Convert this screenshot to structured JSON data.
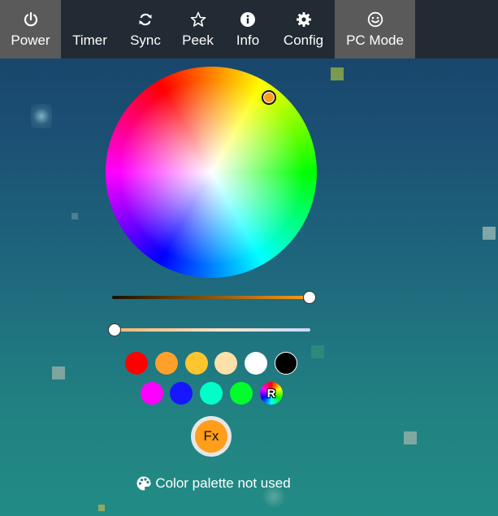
{
  "nav": {
    "tabs": [
      {
        "label": "Power",
        "icon": "power-icon",
        "active": true
      },
      {
        "label": "Timer",
        "icon": "moon-icon",
        "active": false
      },
      {
        "label": "Sync",
        "icon": "sync-icon",
        "active": false
      },
      {
        "label": "Peek",
        "icon": "star-icon",
        "active": false
      },
      {
        "label": "Info",
        "icon": "info-icon",
        "active": false
      },
      {
        "label": "Config",
        "icon": "gear-icon",
        "active": false
      },
      {
        "label": "PC Mode",
        "icon": "smiley-icon",
        "active": true
      }
    ]
  },
  "color_picker": {
    "selected_color": "#ff9e1b",
    "brightness_level": 1.0,
    "white_level": 0.0
  },
  "quick_colors": {
    "row1": [
      "#ff0000",
      "#ffa02a",
      "#ffc52e",
      "#ffe0a8",
      "#ffffff",
      "#000000"
    ],
    "row2": [
      "#ff00ff",
      "#1616ff",
      "#00ffc8",
      "#00ff2a"
    ],
    "random_label": "R"
  },
  "effects_button": {
    "label": "Fx"
  },
  "palette_status": {
    "text": "Color palette not used",
    "icon": "palette-icon"
  },
  "colors": {
    "nav_background": "#222a33",
    "nav_active": "#5a5a5a",
    "accent": "#ff9e1b"
  }
}
